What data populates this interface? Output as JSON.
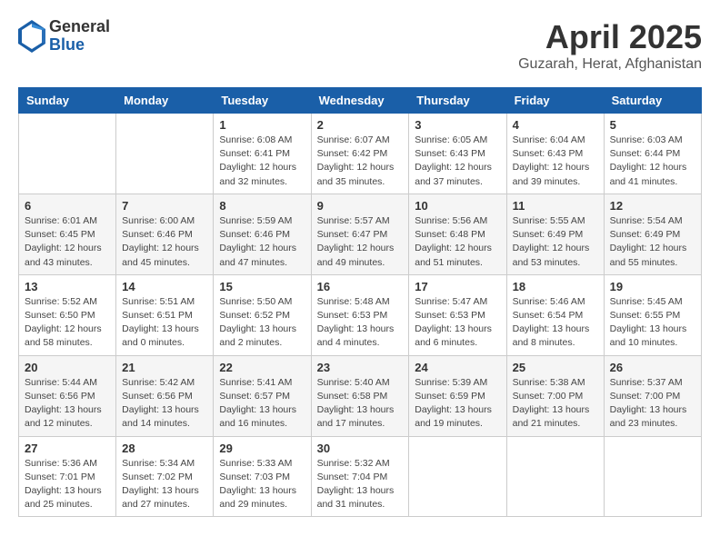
{
  "header": {
    "logo": {
      "line1": "General",
      "line2": "Blue"
    },
    "title": "April 2025",
    "location": "Guzarah, Herat, Afghanistan"
  },
  "calendar": {
    "days_of_week": [
      "Sunday",
      "Monday",
      "Tuesday",
      "Wednesday",
      "Thursday",
      "Friday",
      "Saturday"
    ],
    "weeks": [
      [
        {
          "day": "",
          "info": ""
        },
        {
          "day": "",
          "info": ""
        },
        {
          "day": "1",
          "info": "Sunrise: 6:08 AM\nSunset: 6:41 PM\nDaylight: 12 hours\nand 32 minutes."
        },
        {
          "day": "2",
          "info": "Sunrise: 6:07 AM\nSunset: 6:42 PM\nDaylight: 12 hours\nand 35 minutes."
        },
        {
          "day": "3",
          "info": "Sunrise: 6:05 AM\nSunset: 6:43 PM\nDaylight: 12 hours\nand 37 minutes."
        },
        {
          "day": "4",
          "info": "Sunrise: 6:04 AM\nSunset: 6:43 PM\nDaylight: 12 hours\nand 39 minutes."
        },
        {
          "day": "5",
          "info": "Sunrise: 6:03 AM\nSunset: 6:44 PM\nDaylight: 12 hours\nand 41 minutes."
        }
      ],
      [
        {
          "day": "6",
          "info": "Sunrise: 6:01 AM\nSunset: 6:45 PM\nDaylight: 12 hours\nand 43 minutes."
        },
        {
          "day": "7",
          "info": "Sunrise: 6:00 AM\nSunset: 6:46 PM\nDaylight: 12 hours\nand 45 minutes."
        },
        {
          "day": "8",
          "info": "Sunrise: 5:59 AM\nSunset: 6:46 PM\nDaylight: 12 hours\nand 47 minutes."
        },
        {
          "day": "9",
          "info": "Sunrise: 5:57 AM\nSunset: 6:47 PM\nDaylight: 12 hours\nand 49 minutes."
        },
        {
          "day": "10",
          "info": "Sunrise: 5:56 AM\nSunset: 6:48 PM\nDaylight: 12 hours\nand 51 minutes."
        },
        {
          "day": "11",
          "info": "Sunrise: 5:55 AM\nSunset: 6:49 PM\nDaylight: 12 hours\nand 53 minutes."
        },
        {
          "day": "12",
          "info": "Sunrise: 5:54 AM\nSunset: 6:49 PM\nDaylight: 12 hours\nand 55 minutes."
        }
      ],
      [
        {
          "day": "13",
          "info": "Sunrise: 5:52 AM\nSunset: 6:50 PM\nDaylight: 12 hours\nand 58 minutes."
        },
        {
          "day": "14",
          "info": "Sunrise: 5:51 AM\nSunset: 6:51 PM\nDaylight: 13 hours\nand 0 minutes."
        },
        {
          "day": "15",
          "info": "Sunrise: 5:50 AM\nSunset: 6:52 PM\nDaylight: 13 hours\nand 2 minutes."
        },
        {
          "day": "16",
          "info": "Sunrise: 5:48 AM\nSunset: 6:53 PM\nDaylight: 13 hours\nand 4 minutes."
        },
        {
          "day": "17",
          "info": "Sunrise: 5:47 AM\nSunset: 6:53 PM\nDaylight: 13 hours\nand 6 minutes."
        },
        {
          "day": "18",
          "info": "Sunrise: 5:46 AM\nSunset: 6:54 PM\nDaylight: 13 hours\nand 8 minutes."
        },
        {
          "day": "19",
          "info": "Sunrise: 5:45 AM\nSunset: 6:55 PM\nDaylight: 13 hours\nand 10 minutes."
        }
      ],
      [
        {
          "day": "20",
          "info": "Sunrise: 5:44 AM\nSunset: 6:56 PM\nDaylight: 13 hours\nand 12 minutes."
        },
        {
          "day": "21",
          "info": "Sunrise: 5:42 AM\nSunset: 6:56 PM\nDaylight: 13 hours\nand 14 minutes."
        },
        {
          "day": "22",
          "info": "Sunrise: 5:41 AM\nSunset: 6:57 PM\nDaylight: 13 hours\nand 16 minutes."
        },
        {
          "day": "23",
          "info": "Sunrise: 5:40 AM\nSunset: 6:58 PM\nDaylight: 13 hours\nand 17 minutes."
        },
        {
          "day": "24",
          "info": "Sunrise: 5:39 AM\nSunset: 6:59 PM\nDaylight: 13 hours\nand 19 minutes."
        },
        {
          "day": "25",
          "info": "Sunrise: 5:38 AM\nSunset: 7:00 PM\nDaylight: 13 hours\nand 21 minutes."
        },
        {
          "day": "26",
          "info": "Sunrise: 5:37 AM\nSunset: 7:00 PM\nDaylight: 13 hours\nand 23 minutes."
        }
      ],
      [
        {
          "day": "27",
          "info": "Sunrise: 5:36 AM\nSunset: 7:01 PM\nDaylight: 13 hours\nand 25 minutes."
        },
        {
          "day": "28",
          "info": "Sunrise: 5:34 AM\nSunset: 7:02 PM\nDaylight: 13 hours\nand 27 minutes."
        },
        {
          "day": "29",
          "info": "Sunrise: 5:33 AM\nSunset: 7:03 PM\nDaylight: 13 hours\nand 29 minutes."
        },
        {
          "day": "30",
          "info": "Sunrise: 5:32 AM\nSunset: 7:04 PM\nDaylight: 13 hours\nand 31 minutes."
        },
        {
          "day": "",
          "info": ""
        },
        {
          "day": "",
          "info": ""
        },
        {
          "day": "",
          "info": ""
        }
      ]
    ]
  }
}
